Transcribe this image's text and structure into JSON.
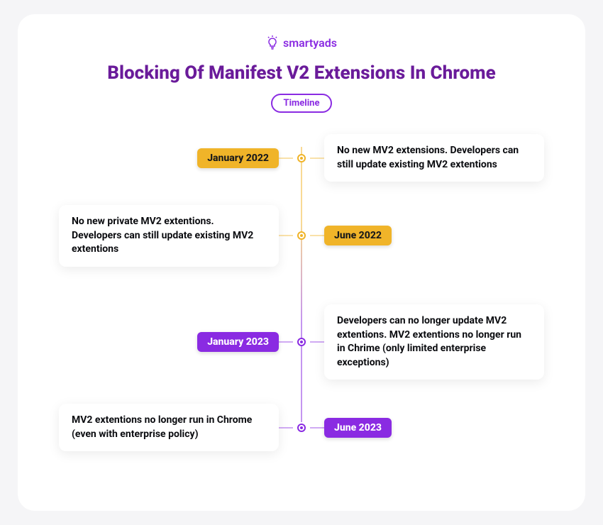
{
  "brand": "smartyads",
  "title": "Blocking Of Manifest V2 Extensions In Chrome",
  "badge": "Timeline",
  "colors": {
    "orange": "#f0b429",
    "purple": "#8a2be2",
    "headline": "#6a1b9a"
  },
  "events": [
    {
      "date": "January 2022",
      "desc": "No new MV2 extensions. Developers can still update existing MV2 extentions",
      "color": "orange",
      "date_side": "left"
    },
    {
      "date": "June 2022",
      "desc": "No new private MV2 extentions. Developers can still update existing MV2 extentions",
      "color": "orange",
      "date_side": "right"
    },
    {
      "date": "January 2023",
      "desc": "Developers can no longer update MV2 extentions. MV2 extentions no longer run in Chrime (only limited enterprise exceptions)",
      "color": "purple",
      "date_side": "left"
    },
    {
      "date": "June 2023",
      "desc": "MV2 extentions no longer run in Chrome (even with enterprise policy)",
      "color": "purple",
      "date_side": "right"
    }
  ]
}
